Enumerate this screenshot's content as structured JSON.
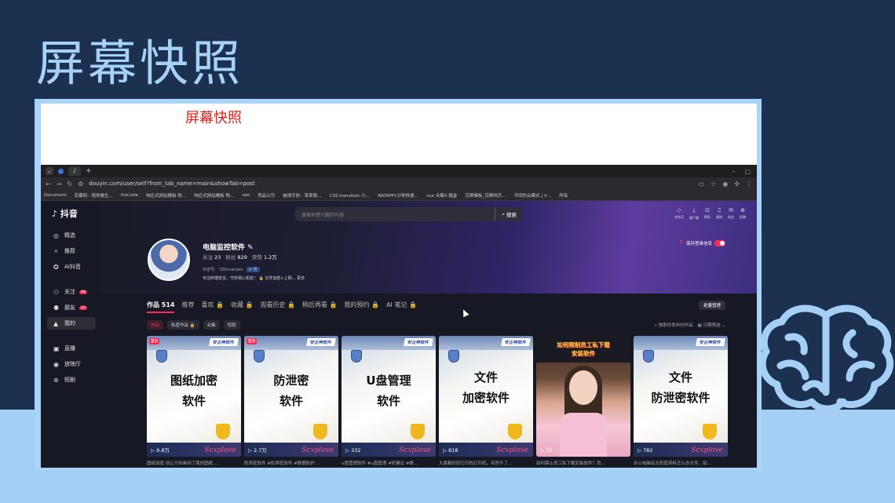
{
  "slide": {
    "title": "屏幕快照",
    "red_caption": "屏幕快照"
  },
  "browser": {
    "url": "douyin.com/user/self?from_tab_name=main&showTab=post",
    "bookmarks": [
      "Document",
      "花瓣网 - 陪你做生…",
      "InsCode",
      "响应式网站模板 购…",
      "响应式网站模板 购…",
      "seo",
      "竞品公司",
      "崩溃手册 - 草率题…",
      "CSS transition 小…",
      "NATAPP1分钟快速…",
      "vue 合集5-掘金",
      "完屏模板_完屏网页…",
      "不同的云模式 | V…",
      "所有"
    ]
  },
  "app": {
    "logo": "抖音",
    "search_placeholder": "搜索你感兴趣的内容",
    "search_button": "搜索",
    "top_icons": [
      {
        "icon": "diamond-icon",
        "label": "充钻石"
      },
      {
        "icon": "download-icon",
        "label": "客户端"
      },
      {
        "icon": "wallpaper-icon",
        "label": "壁纸"
      },
      {
        "icon": "bell-icon",
        "label": "通知"
      },
      {
        "icon": "message-icon",
        "label": "私信"
      },
      {
        "icon": "upload-icon",
        "label": "投稿"
      }
    ],
    "sidebar": [
      {
        "icon": "featured-icon",
        "label": "精选"
      },
      {
        "icon": "recommend-icon",
        "label": "推荐"
      },
      {
        "icon": "ai-icon",
        "label": "AI抖音"
      },
      {
        "icon": "follow-icon",
        "label": "关注",
        "badge": "99"
      },
      {
        "icon": "friends-icon",
        "label": "朋友",
        "badge": "10"
      },
      {
        "icon": "me-icon",
        "label": "我的"
      },
      {
        "icon": "live-icon",
        "label": "直播"
      },
      {
        "icon": "cinema-icon",
        "label": "放映厅"
      },
      {
        "icon": "short-drama-icon",
        "label": "短剧"
      }
    ],
    "profile": {
      "name": "电脑监控软件",
      "follow_label": "关注",
      "follow_count": "23",
      "fans_label": "粉丝",
      "fans_count": "829",
      "likes_label": "获赞",
      "likes_count": "1.2万",
      "id_label": "抖音号:",
      "id_value": "YZDruanjian",
      "gender": "♂ 男",
      "desc": "专注终端安全，守护核心机密！ 🔒 文件加密+上网… 更多",
      "privacy_label": "保存登录信息"
    },
    "tabs": [
      "作品 514",
      "推荐",
      "喜欢 🔒",
      "收藏 🔒",
      "观看历史 🔒",
      "稍后再看 🔒",
      "我的预约 🔒",
      "AI 笔记 🔒"
    ],
    "batch_button": "批量管理",
    "chips": [
      "作品",
      "私密作品 🔒",
      "合集",
      "短剧"
    ],
    "search_works": "搜索你发布的作品",
    "date_filter": "日期筛选",
    "cards": [
      {
        "title_lines": [
          "图纸加密",
          "软件"
        ],
        "plays": "9.8万",
        "tag": "安企神软件",
        "pinned": "置顶",
        "sig": "Scxplove"
      },
      {
        "title_lines": [
          "防泄密",
          "软件"
        ],
        "plays": "2.7万",
        "tag": "安企神软件",
        "pinned": "置顶",
        "sig": "Scxplove"
      },
      {
        "title_lines": [
          "U盘管理",
          "软件"
        ],
        "plays": "332",
        "tag": "安企神软件",
        "pinned": "",
        "sig": "Scxplove"
      },
      {
        "title_lines": [
          "文件",
          "加密软件"
        ],
        "plays": "818",
        "tag": "安企神软件",
        "pinned": "",
        "sig": "Scxplove"
      },
      {
        "title_lines": [
          "如何限制员工私下载",
          "安装软件"
        ],
        "plays": "72",
        "tag": "",
        "pinned": "",
        "sig": ""
      },
      {
        "title_lines": [
          "文件",
          "防泄密软件"
        ],
        "plays": "782",
        "tag": "安企神软件",
        "pinned": "",
        "sig": "Scxplove"
      }
    ],
    "captions": [
      "图纸加密 别让为你画到了我的图纸…",
      "防泄密软件 #防泄密软件 #数据防护…",
      "u盘管理软件 #u盘管理 #好建议 #数…",
      "大家都好好打印的打印机，突然不了…",
      "如何禁止员工私下载安装软件？员…",
      "办公电脑有无机密资料怎么办文件，如…"
    ]
  }
}
